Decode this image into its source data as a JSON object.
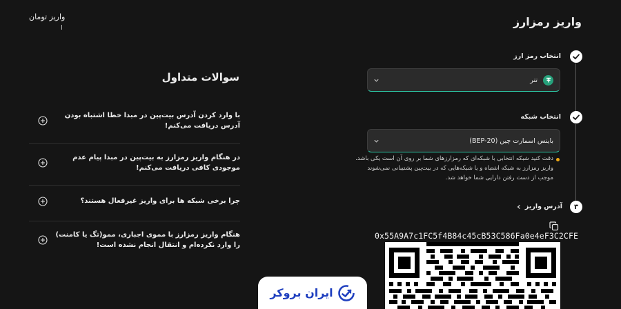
{
  "header": {
    "title": "واریز رمزارز",
    "toman_link": "واریز تومان"
  },
  "steps": {
    "currency": {
      "label": "انتخاب رمز ارز",
      "selected": "تتر",
      "icon": "tether-icon"
    },
    "network": {
      "label": "انتخاب شبکه",
      "selected": "باینس اسمارت چین (BEP-20)",
      "warning": "دقت کنید شبکه انتخابی با شبکه‌ای که رمزارزهای شما بر روی آن است یکی باشد. واریز رمزارز به شبکه اشتباه و یا شبکه‌هایی که در بیت‌پین پشتیبانی نمی‌شوند موجب از دست رفتن دارایی شما خواهد شد."
    },
    "address": {
      "number": "۳",
      "label": "آدرس واریز",
      "value": "0x55A9A7c1FC5f4B84c45cB53C586Fa0e4eF3C2CFE"
    }
  },
  "faq": {
    "title": "سوالات متداول",
    "items": [
      {
        "question": "با وارد کردن آدرس بیت‌پین در مبدا خطا اشتباه بودن آدرس دریافت می‌کنم!"
      },
      {
        "question": "در هنگام واریز رمزارز به بیت‌پین در مبدا پیام عدم موجودی کافی دریافت می‌کنم!"
      },
      {
        "question": "چرا برخی شبکه ها برای واریز غیرفعال هستند؟"
      },
      {
        "question": "هنگام واریز رمزارز با مموی اجباری، ممو(تگ یا کامنت) را وارد نکرده‌ام و انتقال انجام نشده است!"
      }
    ]
  },
  "watermark": {
    "text": "ایران بروکر"
  },
  "colors": {
    "accent": "#2dc6a4",
    "warning": "#f0a914",
    "tether": "#26a17b",
    "brand": "#1f3fbf"
  }
}
